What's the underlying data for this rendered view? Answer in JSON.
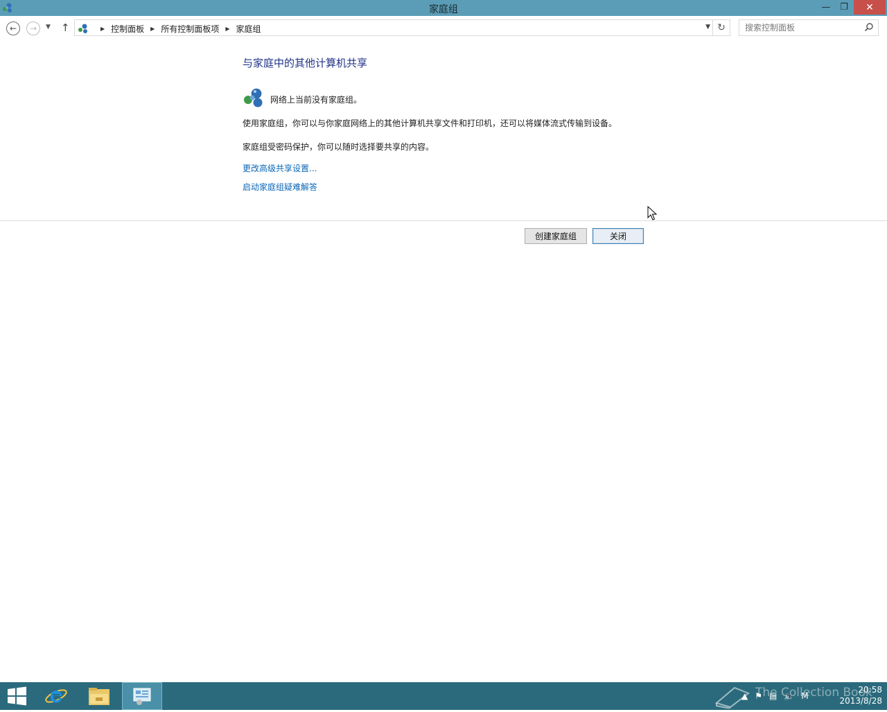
{
  "window": {
    "title": "家庭组",
    "minimize_icon": "minimize-icon",
    "maximize_icon": "restore-icon",
    "close_icon": "close-icon"
  },
  "navigation": {
    "breadcrumbs": [
      "控制面板",
      "所有控制面板项",
      "家庭组"
    ],
    "search_placeholder": "搜索控制面板"
  },
  "main": {
    "heading": "与家庭中的其他计算机共享",
    "status_text": "网络上当前没有家庭组。",
    "description": "使用家庭组，你可以与你家庭网络上的其他计算机共享文件和打印机，还可以将媒体流式传输到设备。",
    "protection_text": "家庭组受密码保护，你可以随时选择要共享的内容。",
    "link_advanced": "更改高级共享设置...",
    "link_troubleshoot": "启动家庭组疑难解答"
  },
  "buttons": {
    "create": "创建家庭组",
    "close": "关闭"
  },
  "taskbar": {
    "items": [
      "start-icon",
      "internet-explorer-icon",
      "file-explorer-icon",
      "control-panel-icon"
    ],
    "watermark": "The Collection Book",
    "time": "20:58",
    "date": "2013/8/28"
  },
  "colors": {
    "titlebar": "#5b9db6",
    "taskbar": "#2b6a7c",
    "heading": "#1e3287",
    "link": "#0a66b7",
    "close_button": "#c7504a"
  }
}
